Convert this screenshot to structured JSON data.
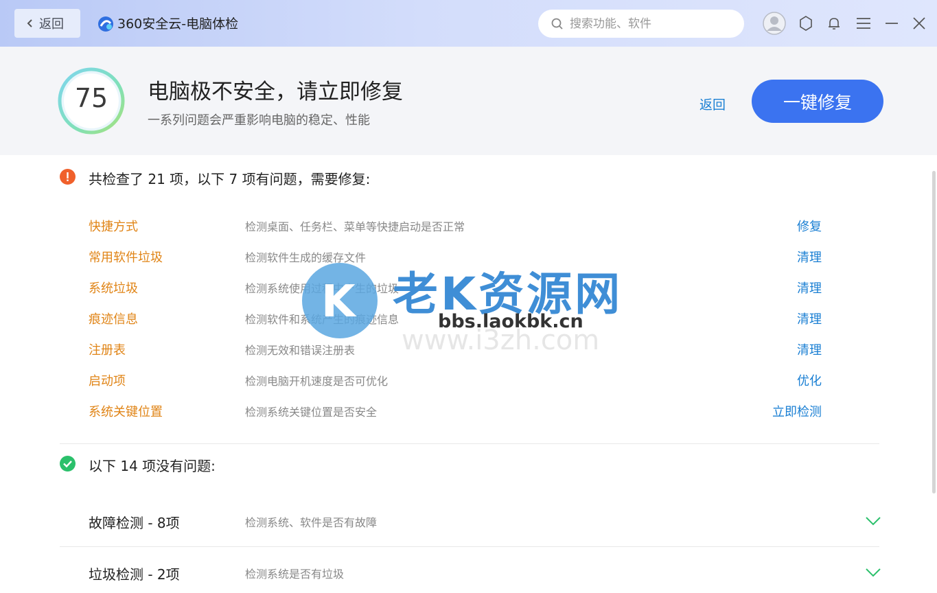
{
  "titlebar": {
    "back_label": "返回",
    "app_title": "360安全云-电脑体检",
    "search_placeholder": "搜索功能、软件"
  },
  "header": {
    "score": "75",
    "title": "电脑极不安全，请立即修复",
    "subtitle": "一系列问题会严重影响电脑的稳定、性能",
    "back_label": "返回",
    "fix_label": "一键修复"
  },
  "issues": {
    "title": "共检查了 21 项，以下 7 项有问题，需要修复:",
    "items": [
      {
        "name": "快捷方式",
        "desc": "检测桌面、任务栏、菜单等快捷启动是否正常",
        "action": "修复"
      },
      {
        "name": "常用软件垃圾",
        "desc": "检测软件生成的缓存文件",
        "action": "清理"
      },
      {
        "name": "系统垃圾",
        "desc": "检测系统使用过程中产生的垃圾",
        "action": "清理"
      },
      {
        "name": "痕迹信息",
        "desc": "检测软件和系统产生的痕迹信息",
        "action": "清理"
      },
      {
        "name": "注册表",
        "desc": "检测无效和错误注册表",
        "action": "清理"
      },
      {
        "name": "启动项",
        "desc": "检测电脑开机速度是否可优化",
        "action": "优化"
      },
      {
        "name": "系统关键位置",
        "desc": "检测系统关键位置是否安全",
        "action": "立即检测"
      }
    ]
  },
  "ok": {
    "title": "以下 14 项没有问题:",
    "groups": [
      {
        "name": "故障检测 - 8项",
        "desc": "检测系统、软件是否有故障"
      },
      {
        "name": "垃圾检测 - 2项",
        "desc": "检测系统是否有垃圾"
      }
    ]
  },
  "watermark": {
    "brand": "老K资源网",
    "url": "bbs.laokbk.cn",
    "ghost_url": "www.i3zh.com",
    "logo_letter": "K"
  },
  "colors": {
    "accent": "#3b73f0",
    "link": "#1a7fd3",
    "issue_name": "#e08416",
    "warn": "#f0602b",
    "ok": "#2bc06b"
  }
}
